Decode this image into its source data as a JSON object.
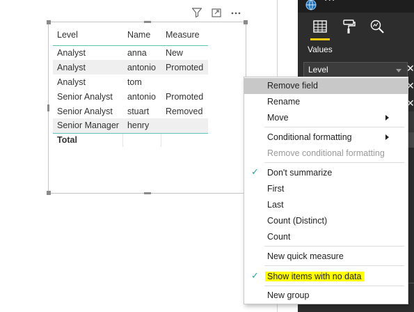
{
  "visual_header": {
    "filter_icon": "filter-icon",
    "focus_icon": "focus-mode-icon",
    "more_icon": "more-options-icon"
  },
  "table": {
    "headers": [
      "Level",
      "Name",
      "Measure"
    ],
    "rows": [
      {
        "level": "Analyst",
        "name": "anna",
        "measure": "New"
      },
      {
        "level": "Analyst",
        "name": "antonio",
        "measure": "Promoted"
      },
      {
        "level": "Analyst",
        "name": "tom",
        "measure": ""
      },
      {
        "level": "Senior Analyst",
        "name": "antonio",
        "measure": "Promoted"
      },
      {
        "level": "Senior Analyst",
        "name": "stuart",
        "measure": "Removed"
      },
      {
        "level": "Senior Manager",
        "name": "henry",
        "measure": ""
      }
    ],
    "total_label": "Total",
    "accent_color": "#5fc3b8"
  },
  "pane": {
    "dots": "···",
    "values_label": "Values",
    "field_chip_label": "Level",
    "close_glyph": "✕",
    "accent_color": "#f2c811"
  },
  "menu": {
    "remove_field": "Remove field",
    "rename": "Rename",
    "move": "Move",
    "conditional_formatting": "Conditional formatting",
    "remove_conditional_formatting": "Remove conditional formatting",
    "dont_summarize": "Don't summarize",
    "first": "First",
    "last": "Last",
    "count_distinct": "Count (Distinct)",
    "count": "Count",
    "new_quick_measure": "New quick measure",
    "show_items_no_data": "Show items with no data",
    "new_group": "New group",
    "check_glyph": "✓",
    "highlight_color": "#ffff00",
    "check_color": "#26a69a"
  }
}
